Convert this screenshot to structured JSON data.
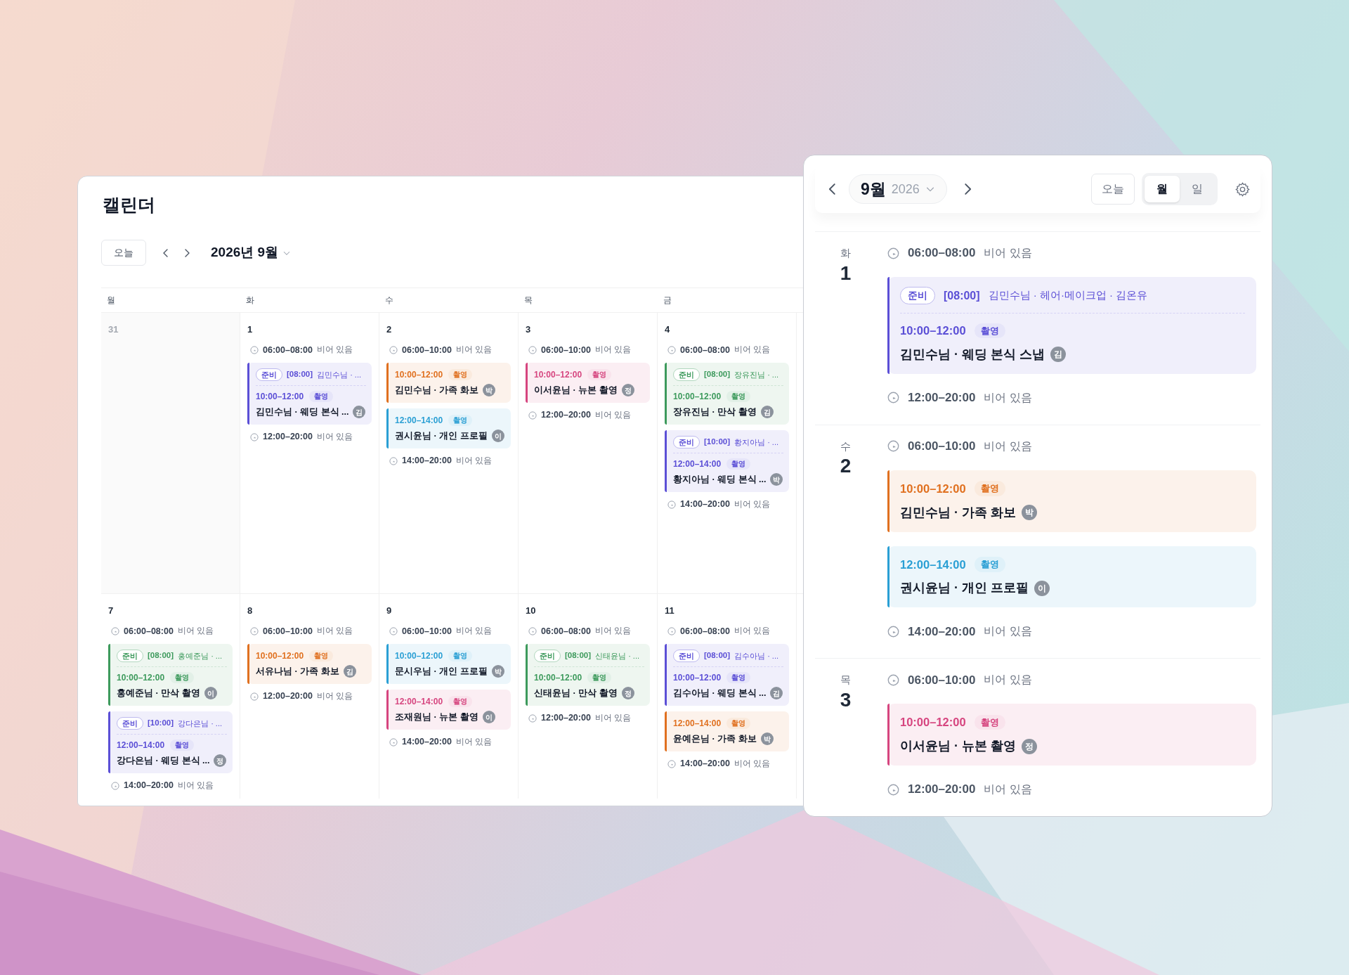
{
  "calendar": {
    "title": "캘린더",
    "today_button": "오늘",
    "month_label": "2026년 9월",
    "weekdays": [
      "월",
      "화",
      "수",
      "목",
      "금"
    ],
    "weeks": [
      {
        "days": [
          {
            "date": "31",
            "muted": true
          },
          {
            "date": "1",
            "muted": false,
            "slots": [
              {
                "kind": "free",
                "time": "06:00–08:00",
                "label": "비어 있음"
              },
              {
                "kind": "event",
                "color": "#5b4fd6",
                "prep": {
                  "badge": "준비",
                  "time": "[08:00]",
                  "text": "김민수님 · ..."
                },
                "time": "10:00–12:00",
                "tag": "촬영",
                "title": "김민수님 · 웨딩 본식 ...",
                "avatar": "김"
              },
              {
                "kind": "free",
                "time": "12:00–20:00",
                "label": "비어 있음"
              }
            ]
          },
          {
            "date": "2",
            "muted": false,
            "slots": [
              {
                "kind": "free",
                "time": "06:00–10:00",
                "label": "비어 있음"
              },
              {
                "kind": "event",
                "color": "#e0701f",
                "time": "10:00–12:00",
                "tag": "촬영",
                "title": "김민수님 · 가족 화보",
                "avatar": "박"
              },
              {
                "kind": "event",
                "color": "#2a9fd4",
                "time": "12:00–14:00",
                "tag": "촬영",
                "title": "권시윤님 · 개인 프로필",
                "avatar": "이"
              },
              {
                "kind": "free",
                "time": "14:00–20:00",
                "label": "비어 있음"
              }
            ]
          },
          {
            "date": "3",
            "muted": false,
            "slots": [
              {
                "kind": "free",
                "time": "06:00–10:00",
                "label": "비어 있음"
              },
              {
                "kind": "event",
                "color": "#d6457f",
                "time": "10:00–12:00",
                "tag": "촬영",
                "title": "이서윤님 · 뉴본 촬영",
                "avatar": "정"
              },
              {
                "kind": "free",
                "time": "12:00–20:00",
                "label": "비어 있음"
              }
            ]
          },
          {
            "date": "4",
            "muted": false,
            "slots": [
              {
                "kind": "free",
                "time": "06:00–08:00",
                "label": "비어 있음"
              },
              {
                "kind": "event",
                "color": "#3d9a5c",
                "prep": {
                  "badge": "준비",
                  "time": "[08:00]",
                  "text": "장유진님 · ..."
                },
                "time": "10:00–12:00",
                "tag": "촬영",
                "title": "장유진님 · 만삭 촬영",
                "avatar": "김"
              },
              {
                "kind": "event",
                "color": "#5b4fd6",
                "prep": {
                  "badge": "준비",
                  "time": "[10:00]",
                  "text": "황지아님 · ..."
                },
                "time": "12:00–14:00",
                "tag": "촬영",
                "title": "황지아님 · 웨딩 본식 ...",
                "avatar": "박"
              },
              {
                "kind": "free",
                "time": "14:00–20:00",
                "label": "비어 있음"
              }
            ]
          }
        ]
      },
      {
        "days": [
          {
            "date": "7",
            "muted": false,
            "slots": [
              {
                "kind": "free",
                "time": "06:00–08:00",
                "label": "비어 있음"
              },
              {
                "kind": "event",
                "color": "#3d9a5c",
                "prep": {
                  "badge": "준비",
                  "time": "[08:00]",
                  "text": "홍예준님 · ..."
                },
                "time": "10:00–12:00",
                "tag": "촬영",
                "title": "홍예준님 · 만삭 촬영",
                "avatar": "이"
              },
              {
                "kind": "event",
                "color": "#5b4fd6",
                "prep": {
                  "badge": "준비",
                  "time": "[10:00]",
                  "text": "강다은님 · ..."
                },
                "time": "12:00–14:00",
                "tag": "촬영",
                "title": "강다은님 · 웨딩 본식 ...",
                "avatar": "정"
              },
              {
                "kind": "free",
                "time": "14:00–20:00",
                "label": "비어 있음"
              }
            ]
          },
          {
            "date": "8",
            "muted": false,
            "slots": [
              {
                "kind": "free",
                "time": "06:00–10:00",
                "label": "비어 있음"
              },
              {
                "kind": "event",
                "color": "#e0701f",
                "time": "10:00–12:00",
                "tag": "촬영",
                "title": "서유나님 · 가족 화보",
                "avatar": "김"
              },
              {
                "kind": "free",
                "time": "12:00–20:00",
                "label": "비어 있음"
              }
            ]
          },
          {
            "date": "9",
            "muted": false,
            "slots": [
              {
                "kind": "free",
                "time": "06:00–10:00",
                "label": "비어 있음"
              },
              {
                "kind": "event",
                "color": "#2a9fd4",
                "time": "10:00–12:00",
                "tag": "촬영",
                "title": "문시우님 · 개인 프로필",
                "avatar": "박"
              },
              {
                "kind": "event",
                "color": "#d6457f",
                "time": "12:00–14:00",
                "tag": "촬영",
                "title": "조재원님 · 뉴본 촬영",
                "avatar": "이"
              },
              {
                "kind": "free",
                "time": "14:00–20:00",
                "label": "비어 있음"
              }
            ]
          },
          {
            "date": "10",
            "muted": false,
            "slots": [
              {
                "kind": "free",
                "time": "06:00–08:00",
                "label": "비어 있음"
              },
              {
                "kind": "event",
                "color": "#3d9a5c",
                "prep": {
                  "badge": "준비",
                  "time": "[08:00]",
                  "text": "신태윤님 · ..."
                },
                "time": "10:00–12:00",
                "tag": "촬영",
                "title": "신태윤님 · 만삭 촬영",
                "avatar": "정"
              },
              {
                "kind": "free",
                "time": "12:00–20:00",
                "label": "비어 있음"
              }
            ]
          },
          {
            "date": "11",
            "muted": false,
            "slots": [
              {
                "kind": "free",
                "time": "06:00–08:00",
                "label": "비어 있음"
              },
              {
                "kind": "event",
                "color": "#5b4fd6",
                "prep": {
                  "badge": "준비",
                  "time": "[08:00]",
                  "text": "김수아님 · ..."
                },
                "time": "10:00–12:00",
                "tag": "촬영",
                "title": "김수아님 · 웨딩 본식 ...",
                "avatar": "김"
              },
              {
                "kind": "event",
                "color": "#e0701f",
                "time": "12:00–14:00",
                "tag": "촬영",
                "title": "윤예은님 · 가족 화보",
                "avatar": "박"
              },
              {
                "kind": "free",
                "time": "14:00–20:00",
                "label": "비어 있음"
              }
            ]
          }
        ]
      }
    ]
  },
  "agenda": {
    "month": "9월",
    "year": "2026",
    "today_button": "오늘",
    "views": [
      {
        "label": "월",
        "selected": true
      },
      {
        "label": "일",
        "selected": false
      }
    ],
    "days": [
      {
        "weekday": "화",
        "date": "1",
        "slots": [
          {
            "kind": "free",
            "time": "06:00–08:00",
            "label": "비어 있음"
          },
          {
            "kind": "event",
            "color": "#5b4fd6",
            "prep": {
              "badge": "준비",
              "time": "[08:00]",
              "text": "김민수님 · 헤어·메이크업 · 김온유"
            },
            "time": "10:00–12:00",
            "tag": "촬영",
            "title": "김민수님 · 웨딩 본식 스냅",
            "avatar": "김"
          },
          {
            "kind": "free",
            "time": "12:00–20:00",
            "label": "비어 있음"
          }
        ]
      },
      {
        "weekday": "수",
        "date": "2",
        "slots": [
          {
            "kind": "free",
            "time": "06:00–10:00",
            "label": "비어 있음"
          },
          {
            "kind": "event",
            "color": "#e0701f",
            "time": "10:00–12:00",
            "tag": "촬영",
            "title": "김민수님 · 가족 화보",
            "avatar": "박"
          },
          {
            "kind": "event",
            "color": "#2a9fd4",
            "time": "12:00–14:00",
            "tag": "촬영",
            "title": "권시윤님 · 개인 프로필",
            "avatar": "이"
          },
          {
            "kind": "free",
            "time": "14:00–20:00",
            "label": "비어 있음"
          }
        ]
      },
      {
        "weekday": "목",
        "date": "3",
        "slots": [
          {
            "kind": "free",
            "time": "06:00–10:00",
            "label": "비어 있음"
          },
          {
            "kind": "event",
            "color": "#d6457f",
            "time": "10:00–12:00",
            "tag": "촬영",
            "title": "이서윤님 · 뉴본 촬영",
            "avatar": "정"
          },
          {
            "kind": "free",
            "time": "12:00–20:00",
            "label": "비어 있음"
          }
        ]
      }
    ]
  }
}
